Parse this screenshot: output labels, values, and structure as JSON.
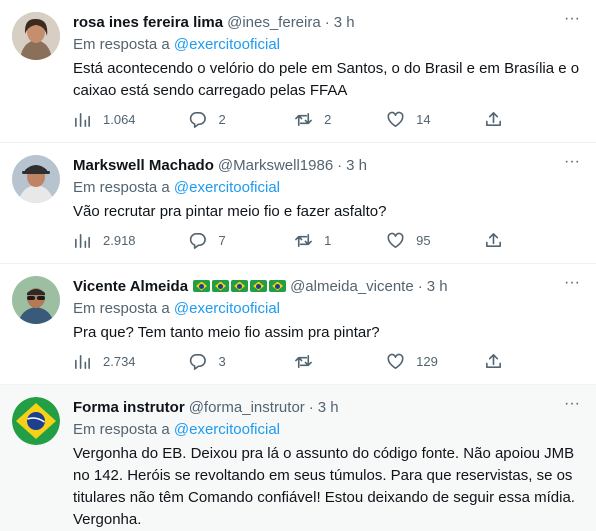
{
  "tweets": [
    {
      "name": "rosa ines fereira lima",
      "handle": "@ines_fereira",
      "time": "3 h",
      "reply_prefix": "Em resposta a",
      "reply_to": "@exercitooficial",
      "text": "Está acontecendo o velório do pele em Santos, o do Brasil e em Brasília e o caixao está sendo carregado pelas FFAA",
      "views": "1.064",
      "replies": "2",
      "retweets": "2",
      "likes": "14"
    },
    {
      "name": "Markswell Machado",
      "handle": "@Markswell1986",
      "time": "3 h",
      "reply_prefix": "Em resposta a",
      "reply_to": "@exercitooficial",
      "text": "Vão recrutar pra pintar meio fio e fazer asfalto?",
      "views": "2.918",
      "replies": "7",
      "retweets": "1",
      "likes": "95"
    },
    {
      "name": "Vicente Almeida",
      "handle": "@almeida_vicente",
      "time": "3 h",
      "reply_prefix": "Em resposta a",
      "reply_to": "@exercitooficial",
      "text": "Pra que? Tem tanto meio fio assim pra pintar?",
      "views": "2.734",
      "replies": "3",
      "retweets": "",
      "likes": "129"
    },
    {
      "name": "Forma instrutor",
      "handle": "@forma_instrutor",
      "time": "3 h",
      "reply_prefix": "Em resposta a",
      "reply_to": "@exercitooficial",
      "text": "Vergonha do EB. Deixou pra lá o assunto do código fonte. Não apoiou JMB no 142. Heróis se revoltando em seus túmulos. Para que reservistas, se os titulares não têm Comando confiável! Estou deixando de seguir essa mídia. Vergonha."
    }
  ],
  "separator": "·",
  "more_glyph": "···",
  "colors": {
    "accent": "#1d9bf0",
    "muted": "#536471",
    "text": "#0f1419"
  },
  "icons": [
    "views-icon",
    "reply-icon",
    "retweet-icon",
    "like-icon",
    "share-icon",
    "more-icon",
    "brazil-flag-icon"
  ]
}
